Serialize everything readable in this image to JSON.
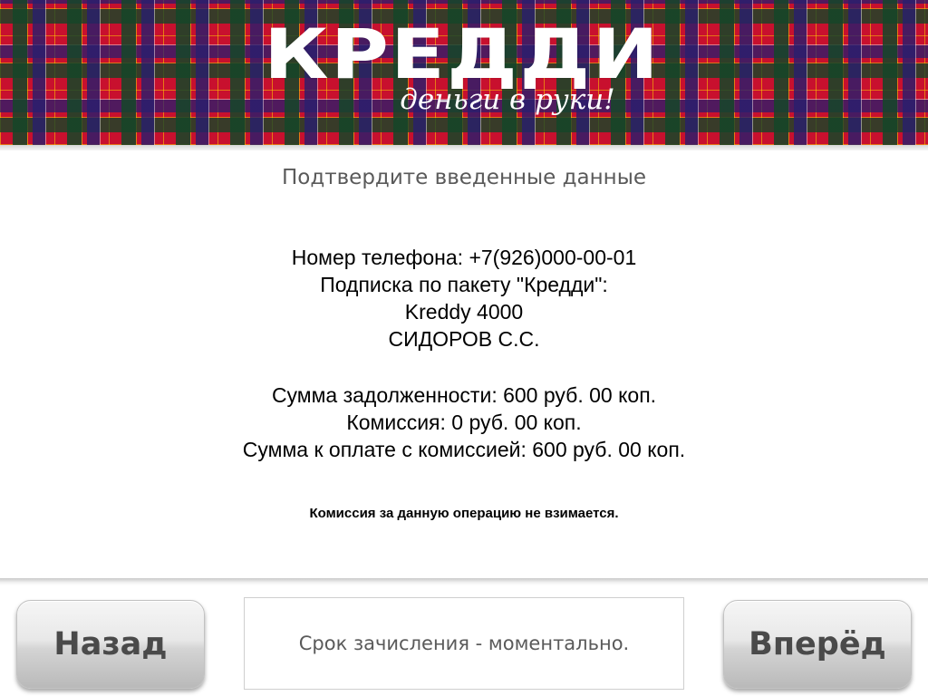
{
  "brand": {
    "logo_text": "КРЕДДИ",
    "tagline": "деньги в руки!"
  },
  "page": {
    "subtitle": "Подтвердите введенные данные"
  },
  "details": {
    "phone_line": "Номер телефона: +7(926)000-00-01",
    "subscription_line": "Подписка по пакету \"Кредди\":",
    "package_line": "Kreddy 4000",
    "name_line": "СИДОРОВ С.С.",
    "debt_line": "Сумма задолженности: 600 руб. 00 коп.",
    "commission_line": "Комиссия: 0 руб. 00 коп.",
    "total_line": "Сумма к оплате с комиссией: 600 руб. 00 коп."
  },
  "notice": "Комиссия за данную операцию не взимается.",
  "footer": {
    "back_label": "Назад",
    "next_label": "Вперёд",
    "info_text": "Срок зачисления - моментально."
  },
  "colors": {
    "header_red": "#c8102e",
    "subtitle_gray": "#5a5a5a",
    "button_text": "#4a4a4a"
  }
}
